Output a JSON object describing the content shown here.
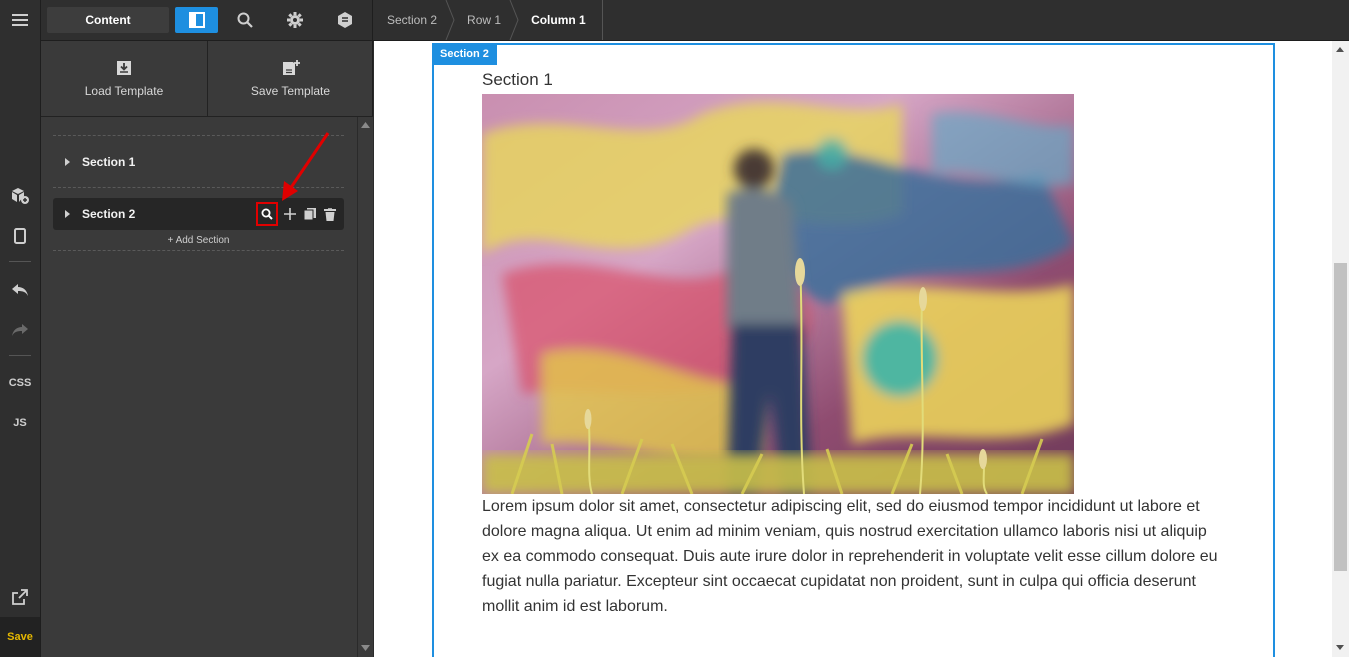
{
  "toolbar": {
    "content_label": "Content"
  },
  "breadcrumb": {
    "items": [
      "Section 2",
      "Row 1",
      "Column 1"
    ]
  },
  "panel": {
    "load_template": "Load Template",
    "save_template": "Save Template",
    "sections": [
      "Section 1",
      "Section 2"
    ],
    "add_section": "+ Add Section"
  },
  "rail": {
    "css_label": "CSS",
    "js_label": "JS",
    "save_label": "Save"
  },
  "canvas": {
    "frame_tag": "Section 2",
    "heading": "Section 1",
    "paragraph": "Lorem ipsum dolor sit amet, consectetur adipiscing elit, sed do eiusmod tempor incididunt ut labore et dolore magna aliqua. Ut enim ad minim veniam, quis nostrud exercitation ullamco laboris nisi ut aliquip ex ea commodo consequat. Duis aute irure dolor in reprehenderit in voluptate velit esse cillum dolore eu fugiat nulla pariatur. Excepteur sint occaecat cupidatat non proident, sunt in culpa qui officia deserunt mollit anim id est laborum."
  },
  "colors": {
    "accent": "#1e8fe0",
    "highlight": "#e00000",
    "save": "#e6b800"
  },
  "icons": [
    "hamburger-icon",
    "layout-icon",
    "search-icon",
    "gear-icon",
    "navigator-icon",
    "download-template-icon",
    "save-template-icon",
    "blocks-icon",
    "mobile-icon",
    "undo-icon",
    "redo-icon",
    "external-link-icon",
    "plus-icon",
    "copy-icon",
    "trash-icon",
    "red-arrow-annotation"
  ]
}
